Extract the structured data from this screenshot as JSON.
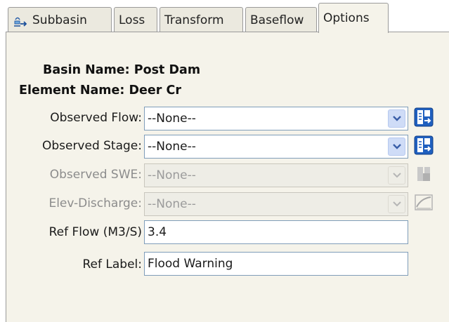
{
  "tabs": [
    {
      "label": "Subbasin",
      "icon": "subbasin-icon"
    },
    {
      "label": "Loss"
    },
    {
      "label": "Transform"
    },
    {
      "label": "Baseflow"
    },
    {
      "label": "Options",
      "active": true
    }
  ],
  "info": {
    "basin_name": "Basin Name: Post Dam",
    "element_name": "Element Name: Deer Cr"
  },
  "fields": {
    "observed_flow": {
      "label": "Observed Flow:",
      "value": "--None--",
      "enabled": true,
      "button_icon": "gage-selector-icon"
    },
    "observed_stage": {
      "label": "Observed Stage:",
      "value": "--None--",
      "enabled": true,
      "button_icon": "gage-selector-icon"
    },
    "observed_swe": {
      "label": "Observed SWE:",
      "value": "--None--",
      "enabled": false,
      "button_icon": "gage-selector-icon"
    },
    "elev_discharge": {
      "label": "Elev-Discharge:",
      "value": "--None--",
      "enabled": false,
      "button_icon": "curve-icon"
    },
    "ref_flow": {
      "label": "Ref Flow (M3/S)",
      "value": "3.4"
    },
    "ref_label": {
      "label": "Ref Label:",
      "value": "Flood Warning"
    }
  },
  "colors": {
    "panel_bg": "#f5f3ea",
    "combo_border": "#7f9db9",
    "arrow_bg": "#cfdcf7",
    "disabled_text": "#8c8c8c"
  }
}
